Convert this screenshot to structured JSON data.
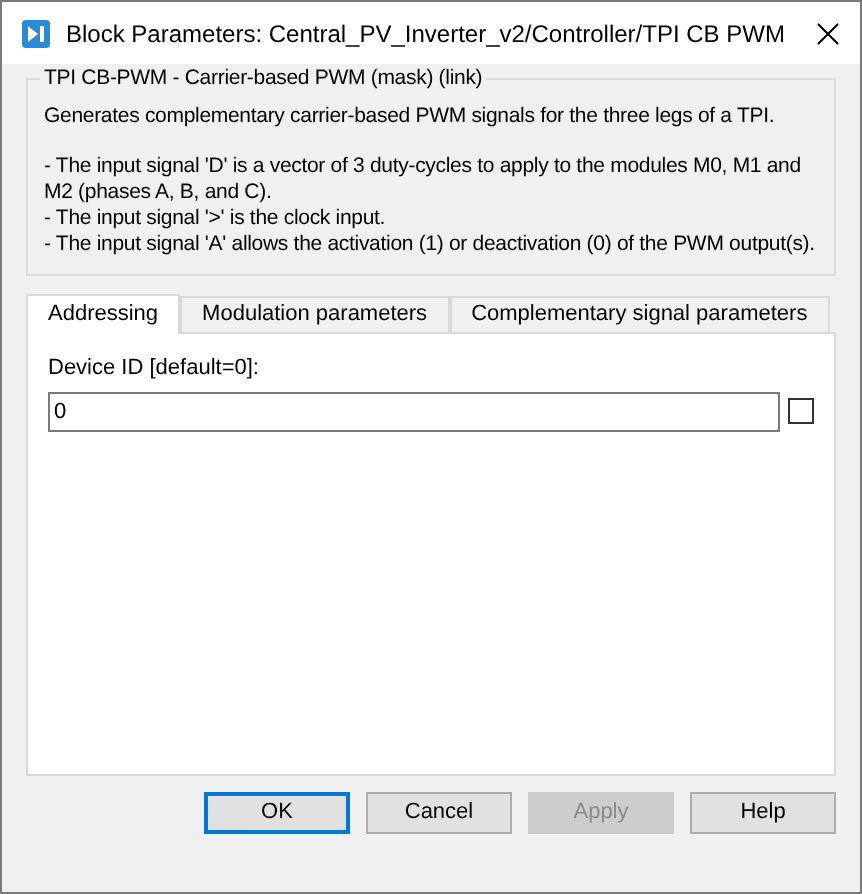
{
  "window": {
    "title": "Block Parameters: Central_PV_Inverter_v2/Controller/TPI CB PWM"
  },
  "group": {
    "title": "TPI CB-PWM - Carrier-based PWM (mask) (link)",
    "paragraphs": [
      "Generates complementary carrier-based PWM signals for the three legs of a TPI.",
      "- The input signal 'D' is a vector of 3 duty-cycles to apply to the modules M0, M1 and M2 (phases A, B, and C).",
      "- The input signal '>' is the clock input.",
      "- The input signal 'A' allows the activation (1) or deactivation (0) of the PWM output(s)."
    ]
  },
  "tabs": [
    {
      "label": "Addressing",
      "selected": true
    },
    {
      "label": "Modulation parameters",
      "selected": false
    },
    {
      "label": "Complementary signal parameters",
      "selected": false
    }
  ],
  "field": {
    "label": "Device ID [default=0]:",
    "value": "0",
    "checked": false
  },
  "buttons": [
    {
      "label": "OK",
      "default": true,
      "disabled": false
    },
    {
      "label": "Cancel",
      "default": false,
      "disabled": false
    },
    {
      "label": "Apply",
      "default": false,
      "disabled": true
    },
    {
      "label": "Help",
      "default": false,
      "disabled": false
    }
  ]
}
